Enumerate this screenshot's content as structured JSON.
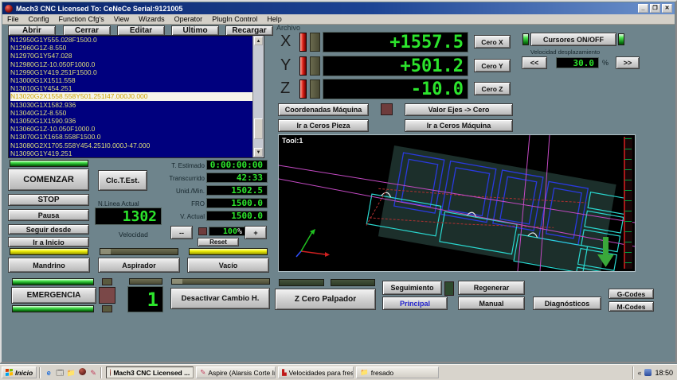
{
  "window": {
    "title": "Mach3 CNC  Licensed To: CeNeCe Serial:9121005",
    "minimize": "_",
    "restore": "❐",
    "close": "✕",
    "menu": [
      "File",
      "Config",
      "Function Cfg's",
      "View",
      "Wizards",
      "Operator",
      "PlugIn Control",
      "Help"
    ]
  },
  "toolbar": {
    "open": "Abrir",
    "close": "Cerrar",
    "edit": "Editar",
    "last": "Último",
    "reload": "Recargar",
    "file_label": "Archivo"
  },
  "gcode": {
    "lines": [
      "N12950G1Y555.028F1500.0",
      "N12960G1Z-8.550",
      "N12970G1Y547.028",
      "N12980G1Z-10.050F1000.0",
      "N12990G1Y419.251F1500.0",
      "N13000G1X1511.558",
      "N13010G1Y454.251",
      "N13020G2X1558.558Y501.251I47.000J0.000",
      "N13030G1X1582.936",
      "N13040G1Z-8.550",
      "N13050G1X1590.936",
      "N13060G1Z-10.050F1000.0",
      "N13070G1X1658.558F1500.0",
      "N13080G2X1705.558Y454.251I0.000J-47.000",
      "N13090G1Y419.251"
    ]
  },
  "dro": {
    "axes": [
      {
        "label": "X",
        "value": "+1557.5",
        "zero": "Cero X"
      },
      {
        "label": "Y",
        "value": "+501.2",
        "zero": "Cero Y"
      },
      {
        "label": "Z",
        "value": "-10.0",
        "zero": "Cero Z"
      }
    ]
  },
  "cursores": {
    "button": "Cursores ON/OFF",
    "speed_label": "Velocidad desplazamiento",
    "dec": "<<",
    "value": "30.0",
    "percent": "%",
    "inc": ">>"
  },
  "coords": {
    "machine": "Coordenadas Máquina",
    "axes_to_zero": "Valor Ejes -> Cero",
    "goto_piece": "Ir a Ceros Pieza",
    "goto_machine": "Ir a Ceros Máquina"
  },
  "toolpath": {
    "tool_label": "Tool:1"
  },
  "run": {
    "start": "COMENZAR",
    "stop": "STOP",
    "pause": "Pausa",
    "run_from": "Seguir desde",
    "goto_start": "Ir a Inicio",
    "calc_time": "Clc.T.Est."
  },
  "timers": {
    "rows": [
      {
        "label": "T. Estimado",
        "value": "0:00:00:00"
      },
      {
        "label": "Transcurrido",
        "value": "42:33"
      },
      {
        "label": "Unid./Min.",
        "value": "1502.5"
      },
      {
        "label": "FRO",
        "value": "1500.0"
      },
      {
        "label": "V. Actual",
        "value": "1500.0"
      }
    ]
  },
  "line": {
    "label": "N.Linea Actual",
    "value": "1302"
  },
  "feed": {
    "label": "Velocidad",
    "dec": "--",
    "value": "100",
    "percent": "%",
    "reset": "Reset",
    "inc": "+"
  },
  "outputs": {
    "spindle": "Mandrino",
    "extractor": "Aspirador",
    "vacuum": "Vacío"
  },
  "estop": {
    "label": "EMERGENCIA"
  },
  "toolchange": {
    "tool_number": "1",
    "disable": "Desactivar Cambio H."
  },
  "screens": {
    "z_probe": "Z Cero Palpador",
    "follow": "Seguimiento",
    "regen": "Regenerar",
    "main": "Principal",
    "manual": "Manual",
    "diagnostics": "Diagnósticos",
    "gcodes": "G-Codes",
    "mcodes": "M-Codes"
  },
  "taskbar": {
    "start": "Inicio",
    "tasks": [
      {
        "label": "Mach3 CNC  Licensed ..."
      },
      {
        "label": "Aspire (Alarsis Corte Ind..."
      },
      {
        "label": "Velocidades para fresad..."
      },
      {
        "label": "fresado"
      }
    ],
    "tray_chevron": "«",
    "clock": "18:50"
  }
}
